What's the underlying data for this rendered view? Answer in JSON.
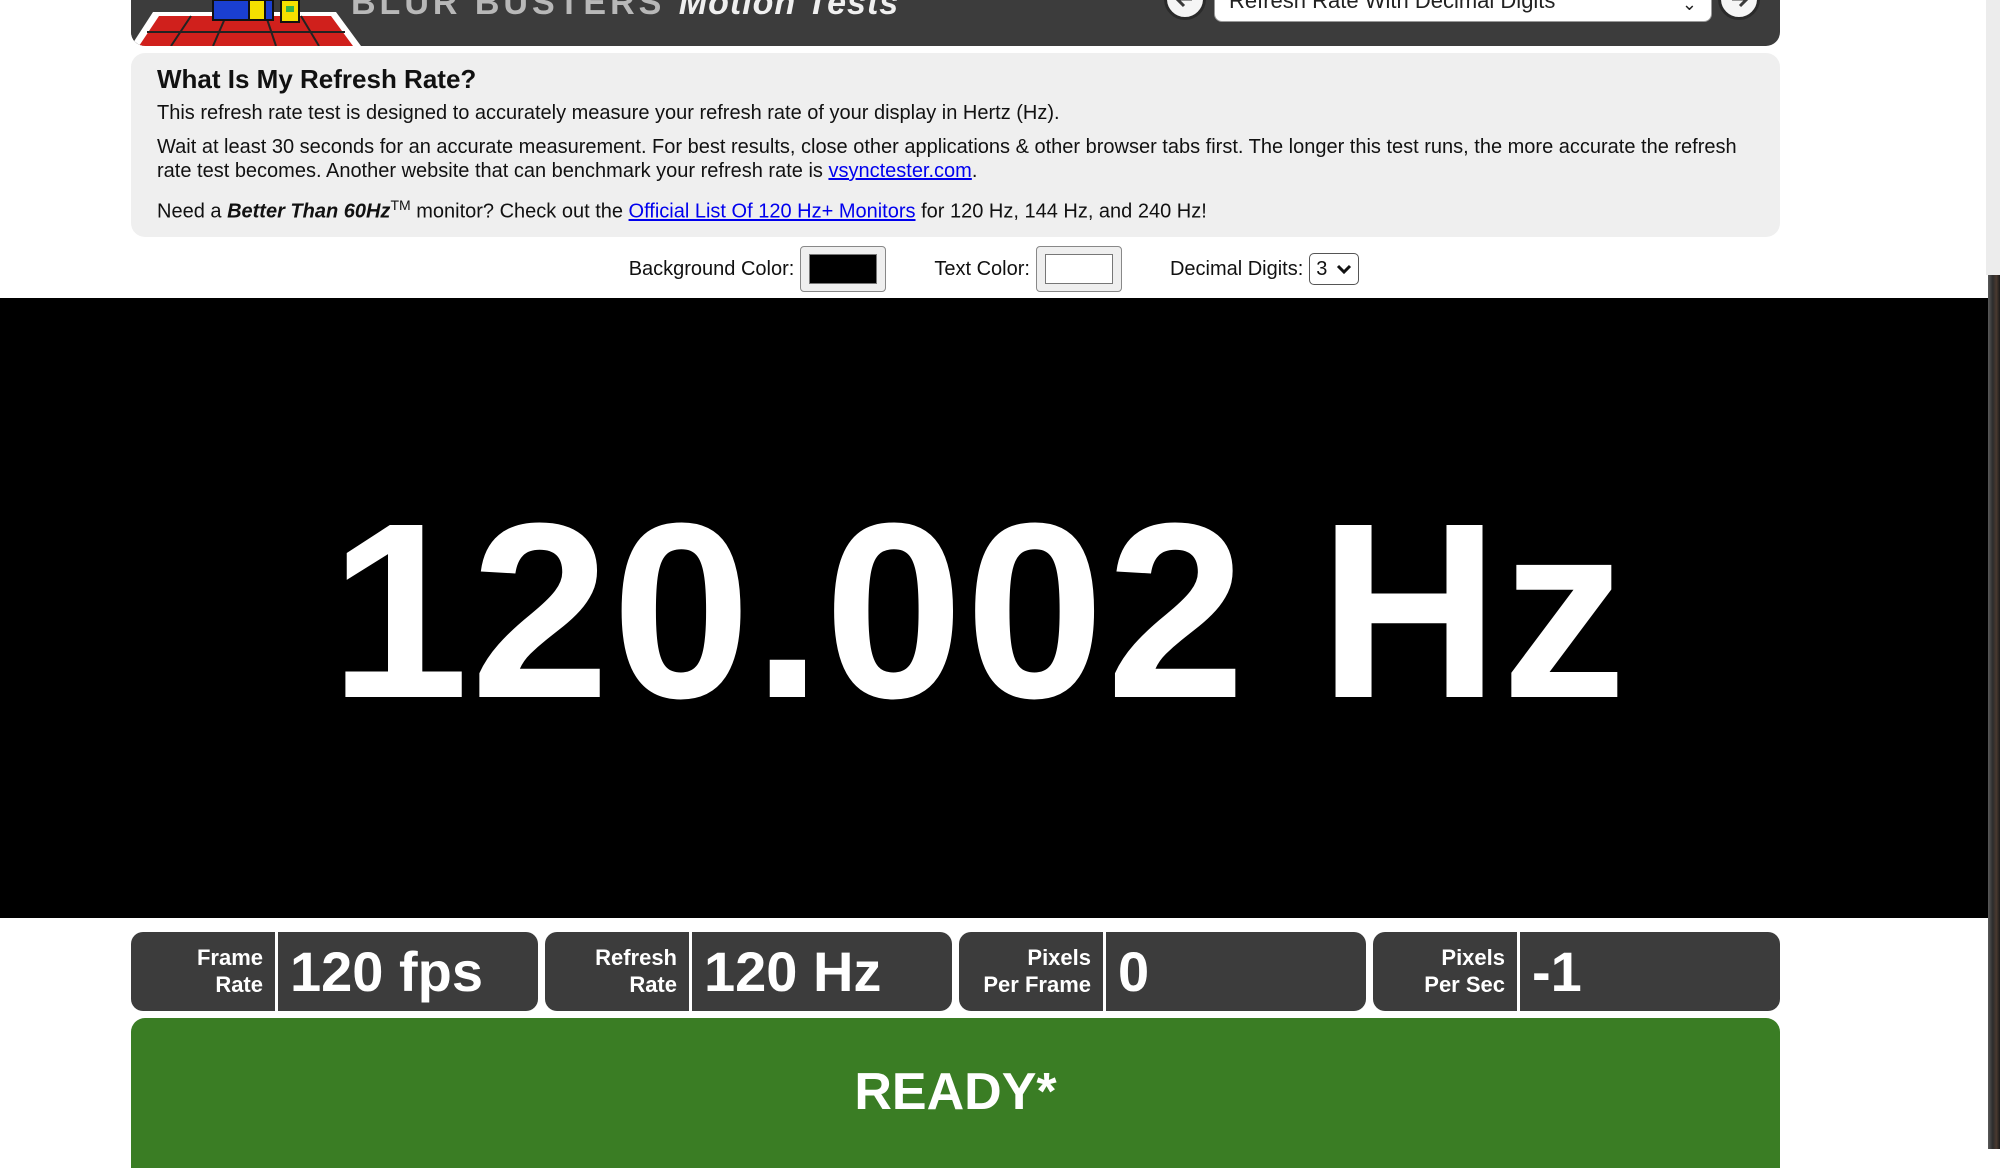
{
  "header": {
    "brand_part1": "BLUR BUSTERS",
    "brand_part2": "Motion Tests",
    "selected_test": "Refresh Rate With Decimal Digits"
  },
  "info": {
    "title": "What Is My Refresh Rate?",
    "p1": "This refresh rate test is designed to accurately measure your refresh rate of your display in Hertz (Hz).",
    "p2_text": "Wait at least 30 seconds for an accurate measurement. For best results, close other applications & other browser tabs first. The longer this test runs, the more accurate the refresh rate test becomes. Another website that can benchmark your refresh rate is ",
    "p2_link": "vsynctester.com",
    "p2_end": ".",
    "p3_prefix": "Need a ",
    "p3_bold": "Better Than 60Hz",
    "p3_tm": "TM",
    "p3_mid": " monitor? Check out the ",
    "p3_link": "Official List Of 120 Hz+ Monitors",
    "p3_suffix": " for 120 Hz, 144 Hz, and 240 Hz!"
  },
  "controls": {
    "bg_label": "Background Color:",
    "bg_color": "#000000",
    "text_label": "Text Color:",
    "text_color": "#ffffff",
    "digits_label": "Decimal Digits:",
    "digits_value": "3"
  },
  "display": {
    "readout": "120.002 Hz"
  },
  "stats": [
    {
      "label": "Frame\nRate",
      "value": "120 fps"
    },
    {
      "label": "Refresh\nRate",
      "value": "120 Hz"
    },
    {
      "label": "Pixels\nPer Frame",
      "value": "0"
    },
    {
      "label": "Pixels\nPer Sec",
      "value": "-1"
    }
  ],
  "status": {
    "text": "READY*",
    "color": "#3a7d24"
  },
  "icons": {
    "prev": "arrow-left-icon",
    "next": "arrow-right-icon",
    "dropdown": "chevron-down-icon"
  }
}
